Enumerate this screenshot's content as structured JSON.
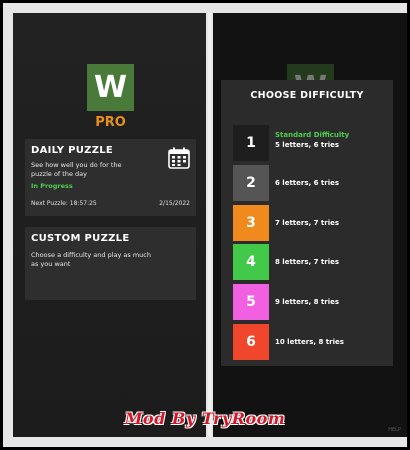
{
  "left": {
    "logo_letter": "W",
    "pro_label": "PRO",
    "daily": {
      "title": "DAILY PUZZLE",
      "description": "See how well you do for the puzzle of the day",
      "status": "In Progress",
      "next_puzzle": "Next Puzzle: 18:57:25",
      "date": "2/15/2022",
      "icon": "calendar-icon"
    },
    "custom": {
      "title": "CUSTOM PUZZLE",
      "description": "Choose a difficulty and play as much as you want"
    }
  },
  "right": {
    "logo_letter": "W",
    "modal_title": "CHOOSE DIFFICULTY",
    "options": [
      {
        "number": "1",
        "tag": "Standard Difficulty",
        "label": "5 letters, 6 tries",
        "color": "#1e1e1e"
      },
      {
        "number": "2",
        "label": "6 letters, 6 tries",
        "color": "#555555"
      },
      {
        "number": "3",
        "label": "7 letters, 7 tries",
        "color": "#f08a1c"
      },
      {
        "number": "4",
        "label": "8 letters, 7 tries",
        "color": "#42c94a"
      },
      {
        "number": "5",
        "label": "9 letters, 8 tries",
        "color": "#f060e0"
      },
      {
        "number": "6",
        "label": "10 letters, 8 tries",
        "color": "#f0462c"
      }
    ],
    "corner_text": "HELP"
  },
  "watermark": "Mod By TryRoom",
  "colors": {
    "logo_green": "#4a7a3a",
    "pro_orange": "#e8901c",
    "status_green": "#4ccf4c",
    "watermark_red": "#d0182a"
  }
}
